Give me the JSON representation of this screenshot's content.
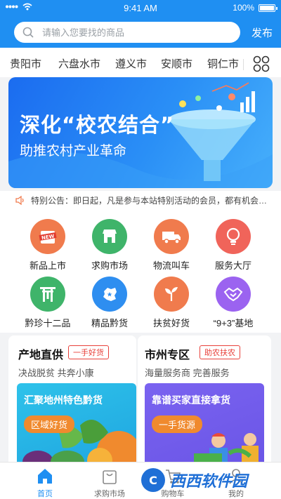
{
  "status_bar": {
    "time": "9:41 AM",
    "battery": "100%"
  },
  "header": {
    "search_placeholder": "请输入您要找的商品",
    "publish_label": "发布"
  },
  "cities": [
    "贵阳市",
    "六盘水市",
    "遵义市",
    "安顺市",
    "铜仁市"
  ],
  "banner": {
    "title": "深化“校农结合”",
    "subtitle": "助推农村产业革命"
  },
  "notice": {
    "text": "特别公告：即日起，凡是参与本站特别活动的会员，都有机会参与抽..."
  },
  "quick_links": [
    {
      "label": "新品上市",
      "icon": "new-badge-icon",
      "color": "#f07b4d"
    },
    {
      "label": "求购市场",
      "icon": "store-icon",
      "color": "#3fb46a"
    },
    {
      "label": "物流叫车",
      "icon": "truck-icon",
      "color": "#f07b4d"
    },
    {
      "label": "服务大厅",
      "icon": "lightbulb-icon",
      "color": "#f0645a"
    },
    {
      "label": "黔珍十二品",
      "icon": "gate-icon",
      "color": "#3fb46a"
    },
    {
      "label": "精品黔货",
      "icon": "map-icon",
      "color": "#2e8ef0"
    },
    {
      "label": "扶贫好货",
      "icon": "sprout-icon",
      "color": "#f07b4d"
    },
    {
      "label": "“9+3”基地",
      "icon": "handshake-icon",
      "color": "#9b63f0"
    }
  ],
  "cards": [
    {
      "title": "产地直供",
      "tag": "一手好货",
      "desc": "决战脱贫 共奔小康",
      "image_title": "汇聚地州特色黔货",
      "image_pill": "区域好货"
    },
    {
      "title": "市州专区",
      "tag": "助农扶农",
      "desc": "海量服务商 完善服务",
      "image_title": "靠谱买家直接拿货",
      "image_pill": "一手货源"
    }
  ],
  "tabbar": [
    {
      "label": "首页",
      "active": true
    },
    {
      "label": "求购市场",
      "active": false
    },
    {
      "label": "购物车",
      "active": false
    },
    {
      "label": "我的",
      "active": false
    }
  ],
  "watermark": "西西软件园"
}
